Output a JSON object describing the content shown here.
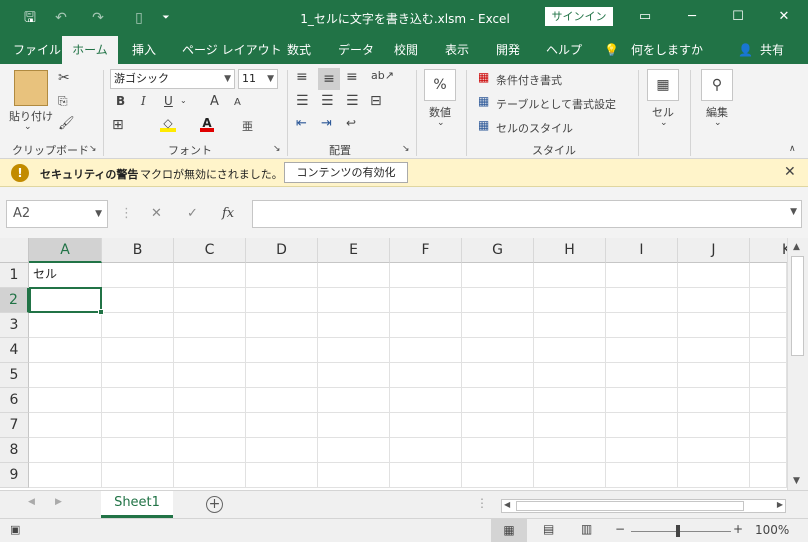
{
  "window": {
    "title": "1_セルに文字を書き込む.xlsm  -  Excel",
    "signin": "サインイン",
    "minimize": "─",
    "restore": "☐",
    "close": "✕"
  },
  "qat": {
    "save": "🖫",
    "undo": "↶",
    "redo": "↷",
    "customize": "⏷"
  },
  "tabs": [
    {
      "label": "ファイル",
      "active": false
    },
    {
      "label": "ホーム",
      "active": true
    },
    {
      "label": "挿入",
      "active": false
    },
    {
      "label": "ページ レイアウト",
      "active": false
    },
    {
      "label": "数式",
      "active": false
    },
    {
      "label": "データ",
      "active": false
    },
    {
      "label": "校閲",
      "active": false
    },
    {
      "label": "表示",
      "active": false
    },
    {
      "label": "開発",
      "active": false
    },
    {
      "label": "ヘルプ",
      "active": false
    }
  ],
  "tell_me": "何をしますか",
  "share": "共有",
  "ribbon": {
    "clipboard": {
      "label": "クリップボード",
      "paste": "貼り付け"
    },
    "font": {
      "label": "フォント",
      "font_name": "游ゴシック",
      "font_size": "11",
      "bold": "B",
      "italic": "I",
      "underline": "U",
      "grow": "A",
      "shrink": "A"
    },
    "alignment": {
      "label": "配置"
    },
    "number": {
      "label": "数値",
      "icon": "%"
    },
    "styles": {
      "label": "スタイル",
      "conditional": "条件付き書式",
      "table": "テーブルとして書式設定",
      "cell_styles": "セルのスタイル"
    },
    "cells": {
      "label": "セル"
    },
    "editing": {
      "label": "編集"
    }
  },
  "security": {
    "title": "セキュリティの警告",
    "message": "マクロが無効にされました。",
    "button": "コンテンツの有効化",
    "icon": "!"
  },
  "formula_bar": {
    "name_box": "A2",
    "cancel": "✕",
    "enter": "✓",
    "fx": "fx",
    "value": ""
  },
  "columns": [
    "A",
    "B",
    "C",
    "D",
    "E",
    "F",
    "G",
    "H",
    "I",
    "J",
    "K"
  ],
  "rows": [
    "1",
    "2",
    "3",
    "4",
    "5",
    "6",
    "7",
    "8",
    "9"
  ],
  "selected": {
    "column": "A",
    "row": "2"
  },
  "cells": {
    "A1": "セル"
  },
  "sheets": [
    {
      "name": "Sheet1",
      "active": true
    }
  ],
  "status": {
    "zoom": "100%",
    "zoom_out": "−",
    "zoom_in": "+"
  }
}
